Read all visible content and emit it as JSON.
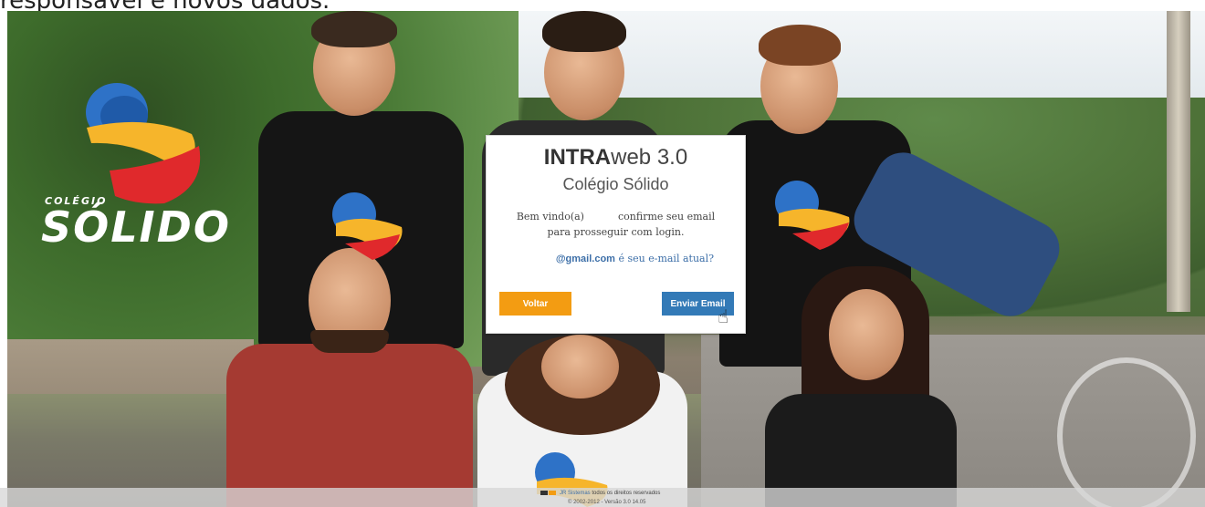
{
  "caption": "responsável e novos dados.",
  "brand": {
    "small": "COLÉGIO",
    "big": "SÓLIDO",
    "colors": {
      "blue": "#2e72c7",
      "yellow": "#f6b52b",
      "red": "#e0292c"
    }
  },
  "modal": {
    "title_bold": "INTRA",
    "title_rest": "web 3.0",
    "subtitle": "Colégio Sólido",
    "message_start": "Bem vindo(a)",
    "message_end": "confirme seu email para prosseguir com login.",
    "email_domain": "@gmail.com",
    "email_question": "é seu e-mail atual?",
    "back_label": "Voltar",
    "send_label": "Enviar Email"
  },
  "footer": {
    "brand": "JR Sistemas",
    "rights": "todos os direitos reservados",
    "version_line": "© 2002-2012 - Versão 3.0 14.05"
  },
  "colors": {
    "accent_orange": "#f39c12",
    "accent_blue": "#337ab7"
  },
  "icons": {
    "cursor": "hand-pointer-icon"
  }
}
